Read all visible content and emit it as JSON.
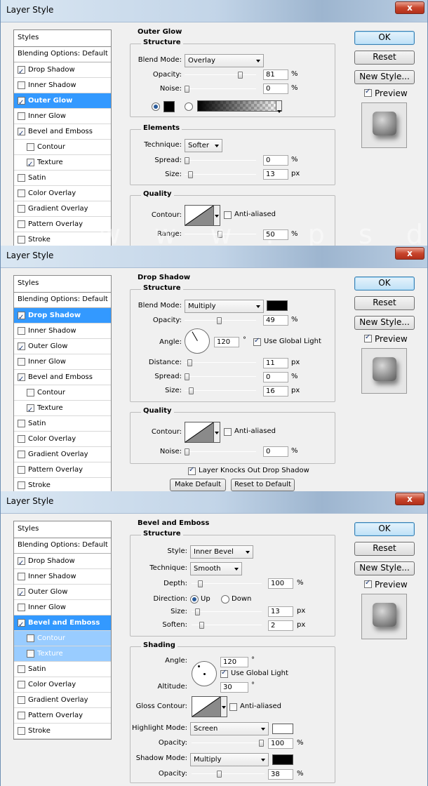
{
  "dialogs": [
    {
      "title": "Layer Style",
      "close": "x",
      "styles_header": "Styles",
      "blending": "Blending Options: Default",
      "items": [
        {
          "label": "Drop Shadow",
          "checked": true
        },
        {
          "label": "Inner Shadow",
          "checked": false
        },
        {
          "label": "Outer Glow",
          "checked": true,
          "selected": true
        },
        {
          "label": "Inner Glow",
          "checked": false
        },
        {
          "label": "Bevel and Emboss",
          "checked": true
        },
        {
          "label": "Contour",
          "checked": false,
          "sub": true
        },
        {
          "label": "Texture",
          "checked": true,
          "sub": true
        },
        {
          "label": "Satin",
          "checked": false
        },
        {
          "label": "Color Overlay",
          "checked": false
        },
        {
          "label": "Gradient Overlay",
          "checked": false
        },
        {
          "label": "Pattern Overlay",
          "checked": false
        },
        {
          "label": "Stroke",
          "checked": false
        }
      ],
      "buttons": {
        "ok": "OK",
        "reset": "Reset",
        "new_style": "New Style...",
        "preview": "Preview"
      },
      "panel": {
        "title": "Outer Glow",
        "structure": "Structure",
        "blend_mode_label": "Blend Mode:",
        "blend_mode": "Overlay",
        "opacity_label": "Opacity:",
        "opacity": "81",
        "opacity_level": 81,
        "noise_label": "Noise:",
        "noise": "0",
        "noise_level": 0,
        "elements": "Elements",
        "technique_label": "Technique:",
        "technique": "Softer",
        "spread_label": "Spread:",
        "spread": "0",
        "spread_level": 0,
        "size_label": "Size:",
        "size": "13",
        "size_level": 5,
        "quality": "Quality",
        "contour_label": "Contour:",
        "anti_aliased": "Anti-aliased",
        "range_label": "Range:",
        "range": "50",
        "range_level": 50,
        "pct": "%",
        "px": "px"
      },
      "watermark": "w w w . p s d d u d e . c o m"
    },
    {
      "title": "Layer Style",
      "close": "x",
      "styles_header": "Styles",
      "blending": "Blending Options: Default",
      "items": [
        {
          "label": "Drop Shadow",
          "checked": true,
          "selected": true
        },
        {
          "label": "Inner Shadow",
          "checked": false
        },
        {
          "label": "Outer Glow",
          "checked": true
        },
        {
          "label": "Inner Glow",
          "checked": false
        },
        {
          "label": "Bevel and Emboss",
          "checked": true
        },
        {
          "label": "Contour",
          "checked": false,
          "sub": true
        },
        {
          "label": "Texture",
          "checked": true,
          "sub": true
        },
        {
          "label": "Satin",
          "checked": false
        },
        {
          "label": "Color Overlay",
          "checked": false
        },
        {
          "label": "Gradient Overlay",
          "checked": false
        },
        {
          "label": "Pattern Overlay",
          "checked": false
        },
        {
          "label": "Stroke",
          "checked": false
        }
      ],
      "buttons": {
        "ok": "OK",
        "reset": "Reset",
        "new_style": "New Style...",
        "preview": "Preview"
      },
      "panel": {
        "title": "Drop Shadow",
        "structure": "Structure",
        "blend_mode_label": "Blend Mode:",
        "blend_mode": "Multiply",
        "opacity_label": "Opacity:",
        "opacity": "49",
        "opacity_level": 49,
        "angle_label": "Angle:",
        "angle": "120",
        "degree": "°",
        "use_global_light": "Use Global Light",
        "distance_label": "Distance:",
        "distance": "11",
        "distance_level": 4,
        "spread_label": "Spread:",
        "spread": "0",
        "spread_level": 0,
        "size_label": "Size:",
        "size": "16",
        "size_level": 6,
        "quality": "Quality",
        "contour_label": "Contour:",
        "anti_aliased": "Anti-aliased",
        "noise_label": "Noise:",
        "noise": "0",
        "noise_level": 0,
        "knockout": "Layer Knocks Out Drop Shadow",
        "make_default": "Make Default",
        "reset_default": "Reset to Default",
        "pct": "%",
        "px": "px"
      }
    },
    {
      "title": "Layer Style",
      "close": "x",
      "styles_header": "Styles",
      "blending": "Blending Options: Default",
      "items": [
        {
          "label": "Drop Shadow",
          "checked": true
        },
        {
          "label": "Inner Shadow",
          "checked": false
        },
        {
          "label": "Outer Glow",
          "checked": true
        },
        {
          "label": "Inner Glow",
          "checked": false
        },
        {
          "label": "Bevel and Emboss",
          "checked": true,
          "selected": true
        },
        {
          "label": "Contour",
          "checked": false,
          "sub": true,
          "selsub": true
        },
        {
          "label": "Texture",
          "checked": false,
          "sub": true,
          "selsub": true
        },
        {
          "label": "Satin",
          "checked": false
        },
        {
          "label": "Color Overlay",
          "checked": false
        },
        {
          "label": "Gradient Overlay",
          "checked": false
        },
        {
          "label": "Pattern Overlay",
          "checked": false
        },
        {
          "label": "Stroke",
          "checked": false
        }
      ],
      "buttons": {
        "ok": "OK",
        "reset": "Reset",
        "new_style": "New Style...",
        "preview": "Preview"
      },
      "panel": {
        "title": "Bevel and Emboss",
        "structure": "Structure",
        "style_label": "Style:",
        "style": "Inner Bevel",
        "technique_label": "Technique:",
        "technique": "Smooth",
        "depth_label": "Depth:",
        "depth": "100",
        "depth_level": 10,
        "direction_label": "Direction:",
        "up": "Up",
        "down": "Down",
        "size_label": "Size:",
        "size": "13",
        "size_level": 5,
        "soften_label": "Soften:",
        "soften": "2",
        "soften_level": 12,
        "shading": "Shading",
        "angle_label": "Angle:",
        "angle": "120",
        "degree": "°",
        "use_global_light": "Use Global Light",
        "altitude_label": "Altitude:",
        "altitude": "30",
        "gloss_label": "Gloss Contour:",
        "anti_aliased": "Anti-aliased",
        "highlight_label": "Highlight Mode:",
        "highlight_mode": "Screen",
        "highlight_opacity_label": "Opacity:",
        "highlight_opacity": "100",
        "highlight_level": 100,
        "shadow_label": "Shadow Mode:",
        "shadow_mode": "Multiply",
        "shadow_opacity_label": "Opacity:",
        "shadow_opacity": "38",
        "shadow_level": 38,
        "pct": "%",
        "px": "px"
      }
    }
  ],
  "colors": {
    "selection": "#3399ff",
    "selection_sub": "#99ccff",
    "black_swatch": "#000000",
    "white_swatch": "#ffffff"
  }
}
